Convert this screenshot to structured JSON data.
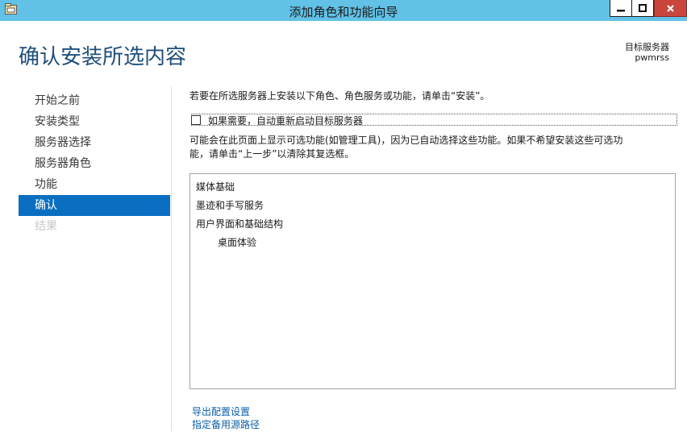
{
  "window": {
    "title": "添加角色和功能向导",
    "minimize_label": "–",
    "maximize_label": "□",
    "close_label": "x"
  },
  "page": {
    "title": "确认安装所选内容",
    "target_server_label": "目标服务器",
    "target_server_name": "pwmrss"
  },
  "nav": {
    "items": [
      {
        "label": "开始之前",
        "state": "normal"
      },
      {
        "label": "安装类型",
        "state": "normal"
      },
      {
        "label": "服务器选择",
        "state": "normal"
      },
      {
        "label": "服务器角色",
        "state": "normal"
      },
      {
        "label": "功能",
        "state": "normal"
      },
      {
        "label": "确认",
        "state": "active"
      },
      {
        "label": "结果",
        "state": "disabled"
      }
    ]
  },
  "main": {
    "instruction": "若要在所选服务器上安装以下角色、角色服务或功能，请单击“安装”。",
    "restart_checkbox": {
      "label": "如果需要，自动重新启动目标服务器",
      "checked": false
    },
    "note_line1": "可能会在此页面上显示可选功能(如管理工具)，因为已自动选择这些功能。如果不希望安装这些可选功",
    "note_line2": "能，请单击“上一步”以清除其复选框。",
    "features": [
      {
        "label": "媒体基础",
        "level": 0
      },
      {
        "label": "墨迹和手写服务",
        "level": 0
      },
      {
        "label": "用户界面和基础结构",
        "level": 0
      },
      {
        "label": "桌面体验",
        "level": 1
      }
    ],
    "links": {
      "export": "导出配置设置",
      "alternate_source": "指定备用源路径"
    }
  },
  "colors": {
    "titlebar": "#62c1e6",
    "page_title": "#1f4e79",
    "nav_active": "#0b6fc1",
    "link": "#0b5fa8",
    "close_button": "#c9463d"
  }
}
